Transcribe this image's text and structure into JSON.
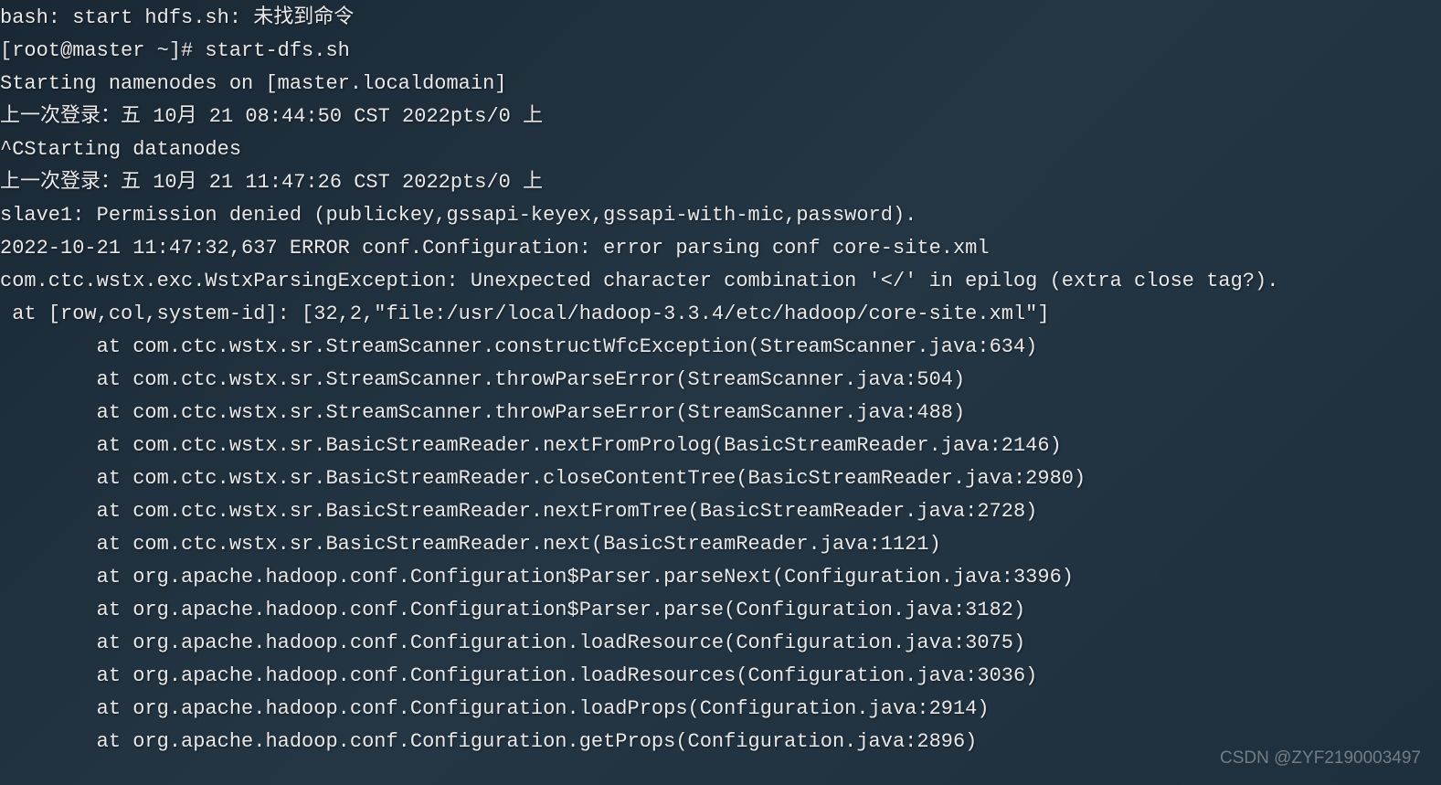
{
  "terminal": {
    "lines": [
      "bash: start hdfs.sh: 未找到命令",
      "[root@master ~]# start-dfs.sh",
      "Starting namenodes on [master.localdomain]",
      "上一次登录：五 10月 21 08:44:50 CST 2022pts/0 上",
      "^CStarting datanodes",
      "上一次登录：五 10月 21 11:47:26 CST 2022pts/0 上",
      "slave1: Permission denied (publickey,gssapi-keyex,gssapi-with-mic,password).",
      "2022-10-21 11:47:32,637 ERROR conf.Configuration: error parsing conf core-site.xml",
      "com.ctc.wstx.exc.WstxParsingException: Unexpected character combination '</' in epilog (extra close tag?).",
      " at [row,col,system-id]: [32,2,\"file:/usr/local/hadoop-3.3.4/etc/hadoop/core-site.xml\"]",
      "        at com.ctc.wstx.sr.StreamScanner.constructWfcException(StreamScanner.java:634)",
      "        at com.ctc.wstx.sr.StreamScanner.throwParseError(StreamScanner.java:504)",
      "        at com.ctc.wstx.sr.StreamScanner.throwParseError(StreamScanner.java:488)",
      "        at com.ctc.wstx.sr.BasicStreamReader.nextFromProlog(BasicStreamReader.java:2146)",
      "        at com.ctc.wstx.sr.BasicStreamReader.closeContentTree(BasicStreamReader.java:2980)",
      "        at com.ctc.wstx.sr.BasicStreamReader.nextFromTree(BasicStreamReader.java:2728)",
      "        at com.ctc.wstx.sr.BasicStreamReader.next(BasicStreamReader.java:1121)",
      "        at org.apache.hadoop.conf.Configuration$Parser.parseNext(Configuration.java:3396)",
      "        at org.apache.hadoop.conf.Configuration$Parser.parse(Configuration.java:3182)",
      "        at org.apache.hadoop.conf.Configuration.loadResource(Configuration.java:3075)",
      "        at org.apache.hadoop.conf.Configuration.loadResources(Configuration.java:3036)",
      "        at org.apache.hadoop.conf.Configuration.loadProps(Configuration.java:2914)",
      "        at org.apache.hadoop.conf.Configuration.getProps(Configuration.java:2896)"
    ]
  },
  "watermark": "CSDN @ZYF2190003497"
}
